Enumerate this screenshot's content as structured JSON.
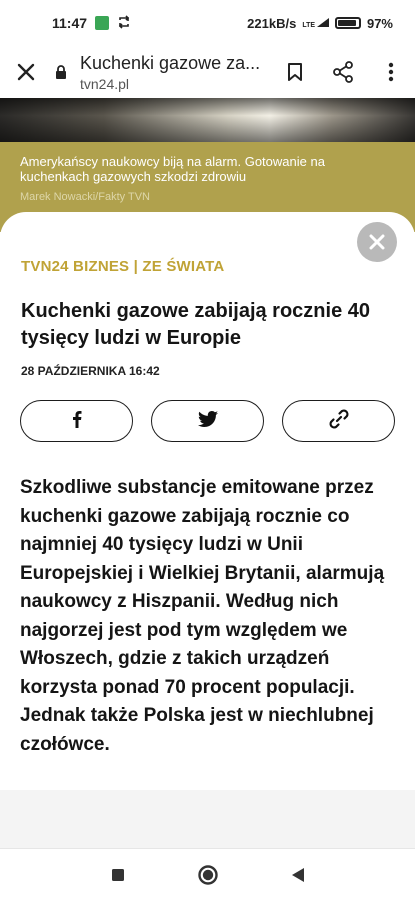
{
  "status_bar": {
    "time": "11:47",
    "network_speed": "221kB/s",
    "network_type": "LTE",
    "battery_percent": "97%",
    "icons": [
      "app-notification-icon",
      "sync-icon",
      "signal-icon",
      "battery-icon"
    ]
  },
  "browser": {
    "page_title": "Kuchenki gazowe za...",
    "url": "tvn24.pl",
    "icons": [
      "close-icon",
      "lock-icon",
      "bookmark-icon",
      "share-icon",
      "more-menu-icon"
    ]
  },
  "hero_caption": {
    "text": "Amerykańscy naukowcy biją na alarm. Gotowanie na kuchenkach gazowych szkodzi zdrowiu",
    "credit": "Marek Nowacki/Fakty TVN"
  },
  "article": {
    "category": "TVN24 BIZNES | ZE ŚWIATA",
    "headline": "Kuchenki gazowe zabijają rocznie 40 tysięcy ludzi w Europie",
    "date": "28 PAŹDZIERNIKA 16:42",
    "share_buttons": [
      "facebook-icon",
      "twitter-icon",
      "link-icon"
    ],
    "lead": "Szkodliwe substancje emitowane przez kuchenki gazowe zabijają rocznie co najmniej 40 tysięcy ludzi w Unii Europejskiej i Wielkiej Brytanii, alarmują naukowcy z Hiszpanii. Według nich najgorzej jest pod tym względem we Włoszech, gdzie z takich urządzeń korzysta ponad 70 procent populacji. Jednak także Polska jest w niechlubnej czołówce."
  },
  "colors": {
    "accent_gold": "#c0a336",
    "caption_bg": "#b0a14d",
    "close_fab": "#b9b9b9"
  },
  "nav_bar": {
    "icons": [
      "recents-square-icon",
      "home-circle-icon",
      "back-triangle-icon"
    ]
  }
}
